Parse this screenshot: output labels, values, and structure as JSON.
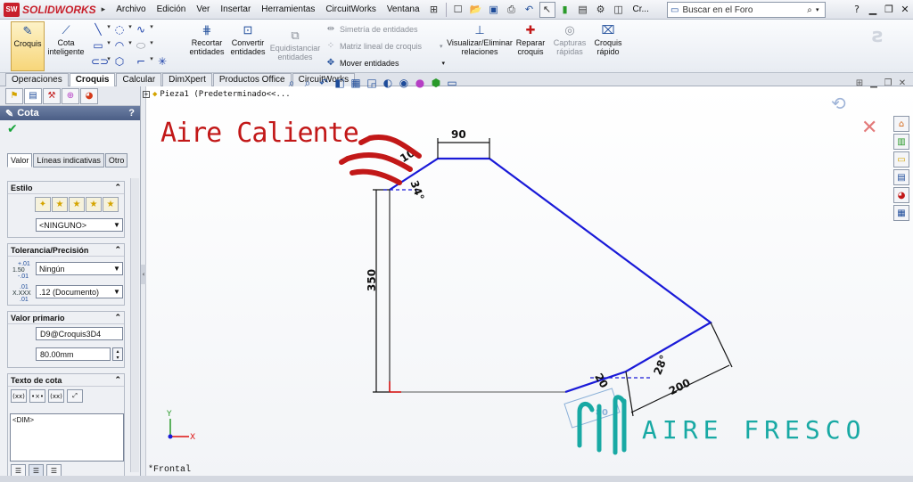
{
  "app": {
    "logo_badge": "SW",
    "logo_text": "SOLIDWORKS"
  },
  "menu": [
    "Archivo",
    "Edición",
    "Ver",
    "Insertar",
    "Herramientas",
    "CircuitWorks",
    "Ventana"
  ],
  "toolbar": {
    "cr_label": "Cr..."
  },
  "search": {
    "placeholder": "Buscar en el Foro"
  },
  "commands": {
    "croquis": "Croquis",
    "cota_line1": "Cota",
    "cota_line2": "inteligente",
    "recortar_line1": "Recortar",
    "recortar_line2": "entidades",
    "convertir_line1": "Convertir",
    "convertir_line2": "entidades",
    "equidistanciar_line1": "Equidistanciar",
    "equidistanciar_line2": "entidades",
    "simetria": "Simetría de entidades",
    "matriz": "Matriz lineal de croquis",
    "mover": "Mover entidades",
    "visualizar_line1": "Visualizar/Eliminar",
    "visualizar_line2": "relaciones",
    "reparar_line1": "Reparar",
    "reparar_line2": "croquis",
    "capturas_line1": "Capturas",
    "capturas_line2": "rápidas",
    "croquisrapido_line1": "Croquis",
    "croquisrapido_line2": "rápido"
  },
  "tabs": [
    "Operaciones",
    "Croquis",
    "Calcular",
    "DimXpert",
    "Productos Office",
    "CircuitWorks"
  ],
  "panel": {
    "title": "Cota",
    "help": "?",
    "subtabs": [
      "Valor",
      "Líneas indicativas",
      "Otro"
    ],
    "estilo": {
      "title": "Estilo",
      "value": "<NINGUNO>"
    },
    "tolerancia": {
      "title": "Tolerancia/Precisión",
      "tol_icon_top": "+.01",
      "tol_icon_mid": "1.50",
      "tol_icon_bot": "-.01",
      "prec_icon_top": ".01",
      "prec_icon_mid": "X.XXX",
      "prec_icon_bot": ".01",
      "tolerance": "Ningún",
      "precision": ".12 (Documento)"
    },
    "valor_primario": {
      "title": "Valor primario",
      "name": "D9@Croquis3D4",
      "value": "80.00mm"
    },
    "texto_cota": {
      "title": "Texto de cota",
      "content": "<DIM>",
      "btn1": "(xx)",
      "btn2": "•×•",
      "btn3": "(xx)"
    }
  },
  "graphics": {
    "tree_label": "Pieza1  (Predeterminado<<...",
    "view_label": "*Frontal",
    "dims": {
      "d90": "90",
      "d10": "10",
      "d34": "34°",
      "d350": "350",
      "d200": "200",
      "d28": "28°",
      "d20": "20",
      "d80": "80"
    },
    "triad_y": "Y",
    "triad_x": "X"
  },
  "annotations": {
    "hot_air": "Aire Caliente",
    "fresh_air": "AIRE FRESCO"
  },
  "colors": {
    "sketch_line": "#1a1ad8",
    "dimension": "#111111",
    "hot_air": "#c21818",
    "fresh_air": "#18a9a4",
    "panel_header": "#5a6b91"
  }
}
